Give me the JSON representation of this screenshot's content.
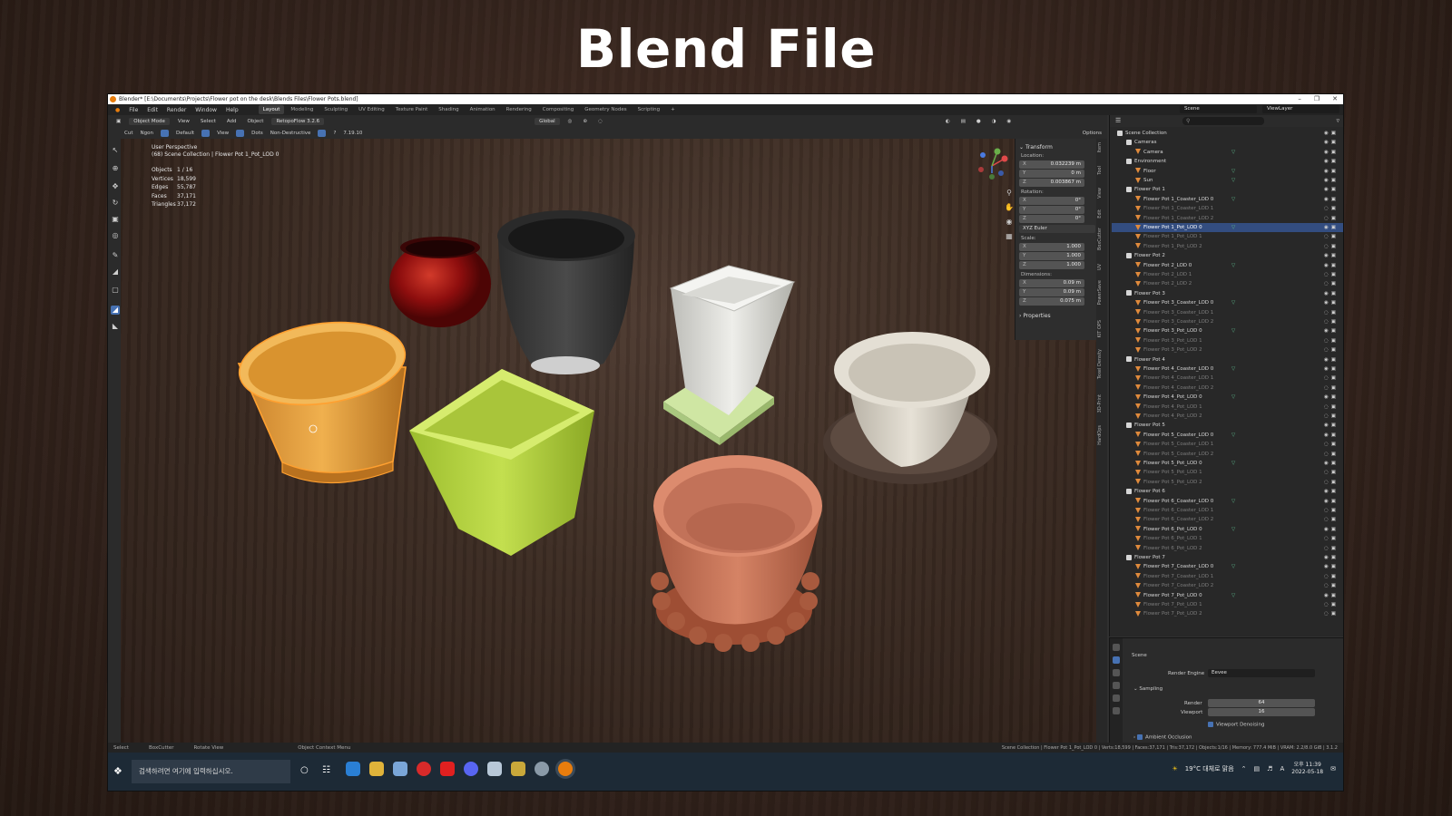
{
  "slide_title": "Blend File",
  "titlebar": {
    "text": "Blender* [E:\\Documents\\Projects\\Flower pot on the desk\\Blends Files\\Flower Pots.blend]"
  },
  "menu": [
    "File",
    "Edit",
    "Render",
    "Window",
    "Help"
  ],
  "workspaces": [
    "Layout",
    "Modeling",
    "Sculpting",
    "UV Editing",
    "Texture Paint",
    "Shading",
    "Animation",
    "Rendering",
    "Compositing",
    "Geometry Nodes",
    "Scripting",
    "+"
  ],
  "scene_field": "Scene",
  "viewlayer_field": "ViewLayer",
  "header": {
    "mode": "Object Mode",
    "view": "View",
    "select": "Select",
    "add": "Add",
    "object": "Object",
    "addon": "RetopoFlow 3.2.6",
    "orientation": "Global"
  },
  "tool_header": {
    "cut": "Cut",
    "ngon": "Ngon",
    "default": "Default",
    "view": "View",
    "dots": "Dots",
    "nondestructive": "Non-Destructive",
    "version": "7.19.10",
    "options": "Options"
  },
  "viewport": {
    "perspective": "User Perspective",
    "path": "(68) Scene Collection | Flower Pot 1_Pot_LOD 0",
    "stats": [
      {
        "k": "Objects",
        "v": "1 / 16"
      },
      {
        "k": "Vertices",
        "v": "18,599"
      },
      {
        "k": "Edges",
        "v": "55,787"
      },
      {
        "k": "Faces",
        "v": "37,171"
      },
      {
        "k": "Triangles",
        "v": "37,172"
      }
    ]
  },
  "colors": {
    "pot_orange": "#e8a84a",
    "pot_red": "#8e0e0e",
    "pot_black": "#3a3a3a",
    "pot_white": "#d9d9d4",
    "pot_lime": "#b6d443",
    "pot_cream": "#d8d3c7",
    "pot_terracotta": "#c9735a",
    "accent_blue": "#4772b3",
    "selection_orange": "#ffa030"
  },
  "npanel": {
    "transform": "Transform",
    "location_label": "Location:",
    "location": [
      {
        "ax": "X",
        "v": "0.032239 m"
      },
      {
        "ax": "Y",
        "v": "0 m"
      },
      {
        "ax": "Z",
        "v": "0.003867 m"
      }
    ],
    "rotation_label": "Rotation:",
    "rotation": [
      {
        "ax": "X",
        "v": "0°"
      },
      {
        "ax": "Y",
        "v": "0°"
      },
      {
        "ax": "Z",
        "v": "0°"
      }
    ],
    "rotation_mode": "XYZ Euler",
    "scale_label": "Scale:",
    "scale": [
      {
        "ax": "X",
        "v": "1.000"
      },
      {
        "ax": "Y",
        "v": "1.000"
      },
      {
        "ax": "Z",
        "v": "1.000"
      }
    ],
    "dimensions_label": "Dimensions:",
    "dimensions": [
      {
        "ax": "X",
        "v": "0.09 m"
      },
      {
        "ax": "Y",
        "v": "0.09 m"
      },
      {
        "ax": "Z",
        "v": "0.075 m"
      }
    ],
    "properties": "Properties"
  },
  "ntabs": [
    "Item",
    "Tool",
    "View",
    "Edit",
    "BoxCutter",
    "UV",
    "PowerSave",
    "KIT OPS",
    "Texel Density",
    "3D-Print",
    "HardOps"
  ],
  "outliner": {
    "search_placeholder": "",
    "rows": [
      {
        "depth": 0,
        "label": "Scene Collection",
        "type": "coll",
        "dim": false,
        "sel": false
      },
      {
        "depth": 1,
        "label": "Cameras",
        "type": "coll",
        "dim": false,
        "sel": false
      },
      {
        "depth": 2,
        "label": "Camera",
        "type": "mesh",
        "dim": false,
        "sel": false
      },
      {
        "depth": 1,
        "label": "Environment",
        "type": "coll",
        "dim": false,
        "sel": false
      },
      {
        "depth": 2,
        "label": "Floor",
        "type": "mesh",
        "dim": false,
        "sel": false
      },
      {
        "depth": 2,
        "label": "Sun",
        "type": "mesh",
        "dim": false,
        "sel": false
      },
      {
        "depth": 1,
        "label": "Flower Pot 1",
        "type": "coll",
        "dim": false,
        "sel": false
      },
      {
        "depth": 2,
        "label": "Flower Pot 1_Coaster_LOD 0",
        "type": "mesh",
        "dim": false,
        "sel": false
      },
      {
        "depth": 2,
        "label": "Flower Pot 1_Coaster_LOD 1",
        "type": "mesh",
        "dim": true,
        "sel": false
      },
      {
        "depth": 2,
        "label": "Flower Pot 1_Coaster_LOD 2",
        "type": "mesh",
        "dim": true,
        "sel": false
      },
      {
        "depth": 2,
        "label": "Flower Pot 1_Pot_LOD 0",
        "type": "mesh",
        "dim": false,
        "sel": true
      },
      {
        "depth": 2,
        "label": "Flower Pot 1_Pot_LOD 1",
        "type": "mesh",
        "dim": true,
        "sel": false
      },
      {
        "depth": 2,
        "label": "Flower Pot 1_Pot_LOD 2",
        "type": "mesh",
        "dim": true,
        "sel": false
      },
      {
        "depth": 1,
        "label": "Flower Pot 2",
        "type": "coll",
        "dim": false,
        "sel": false
      },
      {
        "depth": 2,
        "label": "Flower Pot 2_LOD 0",
        "type": "mesh",
        "dim": false,
        "sel": false
      },
      {
        "depth": 2,
        "label": "Flower Pot 2_LOD 1",
        "type": "mesh",
        "dim": true,
        "sel": false
      },
      {
        "depth": 2,
        "label": "Flower Pot 2_LOD 2",
        "type": "mesh",
        "dim": true,
        "sel": false
      },
      {
        "depth": 1,
        "label": "Flower Pot 3",
        "type": "coll",
        "dim": false,
        "sel": false
      },
      {
        "depth": 2,
        "label": "Flower Pot 3_Coaster_LOD 0",
        "type": "mesh",
        "dim": false,
        "sel": false
      },
      {
        "depth": 2,
        "label": "Flower Pot 3_Coaster_LOD 1",
        "type": "mesh",
        "dim": true,
        "sel": false
      },
      {
        "depth": 2,
        "label": "Flower Pot 3_Coaster_LOD 2",
        "type": "mesh",
        "dim": true,
        "sel": false
      },
      {
        "depth": 2,
        "label": "Flower Pot 3_Pot_LOD 0",
        "type": "mesh",
        "dim": false,
        "sel": false
      },
      {
        "depth": 2,
        "label": "Flower Pot 3_Pot_LOD 1",
        "type": "mesh",
        "dim": true,
        "sel": false
      },
      {
        "depth": 2,
        "label": "Flower Pot 3_Pot_LOD 2",
        "type": "mesh",
        "dim": true,
        "sel": false
      },
      {
        "depth": 1,
        "label": "Flower Pot 4",
        "type": "coll",
        "dim": false,
        "sel": false
      },
      {
        "depth": 2,
        "label": "Flower Pot 4_Coaster_LOD 0",
        "type": "mesh",
        "dim": false,
        "sel": false
      },
      {
        "depth": 2,
        "label": "Flower Pot 4_Coaster_LOD 1",
        "type": "mesh",
        "dim": true,
        "sel": false
      },
      {
        "depth": 2,
        "label": "Flower Pot 4_Coaster_LOD 2",
        "type": "mesh",
        "dim": true,
        "sel": false
      },
      {
        "depth": 2,
        "label": "Flower Pot 4_Pot_LOD 0",
        "type": "mesh",
        "dim": false,
        "sel": false
      },
      {
        "depth": 2,
        "label": "Flower Pot 4_Pot_LOD 1",
        "type": "mesh",
        "dim": true,
        "sel": false
      },
      {
        "depth": 2,
        "label": "Flower Pot 4_Pot_LOD 2",
        "type": "mesh",
        "dim": true,
        "sel": false
      },
      {
        "depth": 1,
        "label": "Flower Pot 5",
        "type": "coll",
        "dim": false,
        "sel": false
      },
      {
        "depth": 2,
        "label": "Flower Pot 5_Coaster_LOD 0",
        "type": "mesh",
        "dim": false,
        "sel": false
      },
      {
        "depth": 2,
        "label": "Flower Pot 5_Coaster_LOD 1",
        "type": "mesh",
        "dim": true,
        "sel": false
      },
      {
        "depth": 2,
        "label": "Flower Pot 5_Coaster_LOD 2",
        "type": "mesh",
        "dim": true,
        "sel": false
      },
      {
        "depth": 2,
        "label": "Flower Pot 5_Pot_LOD 0",
        "type": "mesh",
        "dim": false,
        "sel": false
      },
      {
        "depth": 2,
        "label": "Flower Pot 5_Pot_LOD 1",
        "type": "mesh",
        "dim": true,
        "sel": false
      },
      {
        "depth": 2,
        "label": "Flower Pot 5_Pot_LOD 2",
        "type": "mesh",
        "dim": true,
        "sel": false
      },
      {
        "depth": 1,
        "label": "Flower Pot 6",
        "type": "coll",
        "dim": false,
        "sel": false
      },
      {
        "depth": 2,
        "label": "Flower Pot 6_Coaster_LOD 0",
        "type": "mesh",
        "dim": false,
        "sel": false
      },
      {
        "depth": 2,
        "label": "Flower Pot 6_Coaster_LOD 1",
        "type": "mesh",
        "dim": true,
        "sel": false
      },
      {
        "depth": 2,
        "label": "Flower Pot 6_Coaster_LOD 2",
        "type": "mesh",
        "dim": true,
        "sel": false
      },
      {
        "depth": 2,
        "label": "Flower Pot 6_Pot_LOD 0",
        "type": "mesh",
        "dim": false,
        "sel": false
      },
      {
        "depth": 2,
        "label": "Flower Pot 6_Pot_LOD 1",
        "type": "mesh",
        "dim": true,
        "sel": false
      },
      {
        "depth": 2,
        "label": "Flower Pot 6_Pot_LOD 2",
        "type": "mesh",
        "dim": true,
        "sel": false
      },
      {
        "depth": 1,
        "label": "Flower Pot 7",
        "type": "coll",
        "dim": false,
        "sel": false
      },
      {
        "depth": 2,
        "label": "Flower Pot 7_Coaster_LOD 0",
        "type": "mesh",
        "dim": false,
        "sel": false
      },
      {
        "depth": 2,
        "label": "Flower Pot 7_Coaster_LOD 1",
        "type": "mesh",
        "dim": true,
        "sel": false
      },
      {
        "depth": 2,
        "label": "Flower Pot 7_Coaster_LOD 2",
        "type": "mesh",
        "dim": true,
        "sel": false
      },
      {
        "depth": 2,
        "label": "Flower Pot 7_Pot_LOD 0",
        "type": "mesh",
        "dim": false,
        "sel": false
      },
      {
        "depth": 2,
        "label": "Flower Pot 7_Pot_LOD 1",
        "type": "mesh",
        "dim": true,
        "sel": false
      },
      {
        "depth": 2,
        "label": "Flower Pot 7_Pot_LOD 2",
        "type": "mesh",
        "dim": true,
        "sel": false
      }
    ]
  },
  "properties": {
    "scene": "Scene",
    "render_engine_label": "Render Engine",
    "render_engine": "Eevee",
    "sampling": "Sampling",
    "render_label": "Render",
    "render_value": "64",
    "viewport_label": "Viewport",
    "viewport_value": "16",
    "viewport_denoising": "Viewport Denoising",
    "ambient_occlusion": "Ambient Occlusion"
  },
  "statusbar": {
    "select": "Select",
    "boxcutter": "BoxCutter",
    "rotate_view": "Rotate View",
    "context_menu": "Object Context Menu",
    "info": "Scene Collection | Flower Pot 1_Pot_LOD 0 | Verts:18,599 | Faces:37,171 | Tris:37,172 | Objects:1/16 | Memory: 777.4 MiB | VRAM: 2.2/8.0 GiB | 3.1.2"
  },
  "taskbar": {
    "search_placeholder": "검색하려면 여기에 입력하십시오.",
    "weather": "19°C 대체로 맑음",
    "lang": "A",
    "time": "오후 11:39",
    "date": "2022-05-18"
  }
}
